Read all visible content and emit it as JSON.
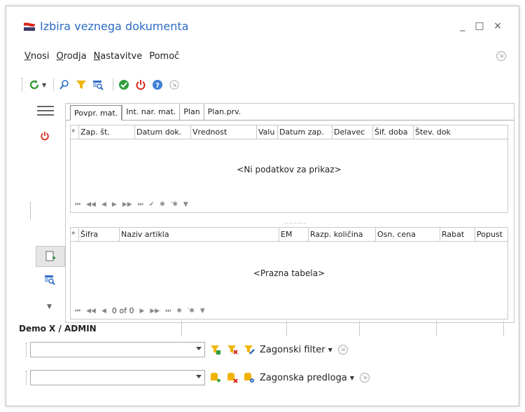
{
  "window": {
    "title": "Izbira veznega dokumenta",
    "minimize": "_",
    "maximize": "□",
    "close": "×"
  },
  "menu": {
    "items": [
      {
        "label": "Vnosi",
        "underline": "V",
        "rest": "nosi"
      },
      {
        "label": "Orodja",
        "underline": "O",
        "rest": "rodja"
      },
      {
        "label": "Nastavitve",
        "underline": "N",
        "rest": "astavitve"
      },
      {
        "label": "Pomoč",
        "underline": "",
        "rest": "Pomoč"
      }
    ]
  },
  "tabs": [
    "Povpr. mat.",
    "Int. nar. mat.",
    "Plan",
    "Plan.prv."
  ],
  "upper_grid": {
    "columns": [
      "*",
      "Zap. št.",
      "Datum dok.",
      "Vrednost",
      "Valu",
      "Datum zap.",
      "Delavec",
      "Šif. doba",
      "Štev. dok"
    ],
    "empty_message": "<Ni podatkov za prikaz>"
  },
  "lower_grid": {
    "columns": [
      "*",
      "Šifra",
      "Naziv artikla",
      "EM",
      "Razp. količina",
      "Osn. cena",
      "Rabat",
      "Popust"
    ],
    "empty_message": "<Prazna tabela>",
    "record_count": "0 of 0"
  },
  "status": {
    "user": "Demo X / ADMIN"
  },
  "filter": {
    "value": "",
    "label": "Zagonski filter"
  },
  "template": {
    "value": "",
    "label": "Zagonska predloga"
  },
  "colors": {
    "accent": "#2b6cc4",
    "refresh_green": "#3a9a3a",
    "filter_yellow": "#f0b400",
    "ok_green": "#2e9e3e",
    "power_red": "#d9261c",
    "help_blue": "#3d7fd6"
  }
}
